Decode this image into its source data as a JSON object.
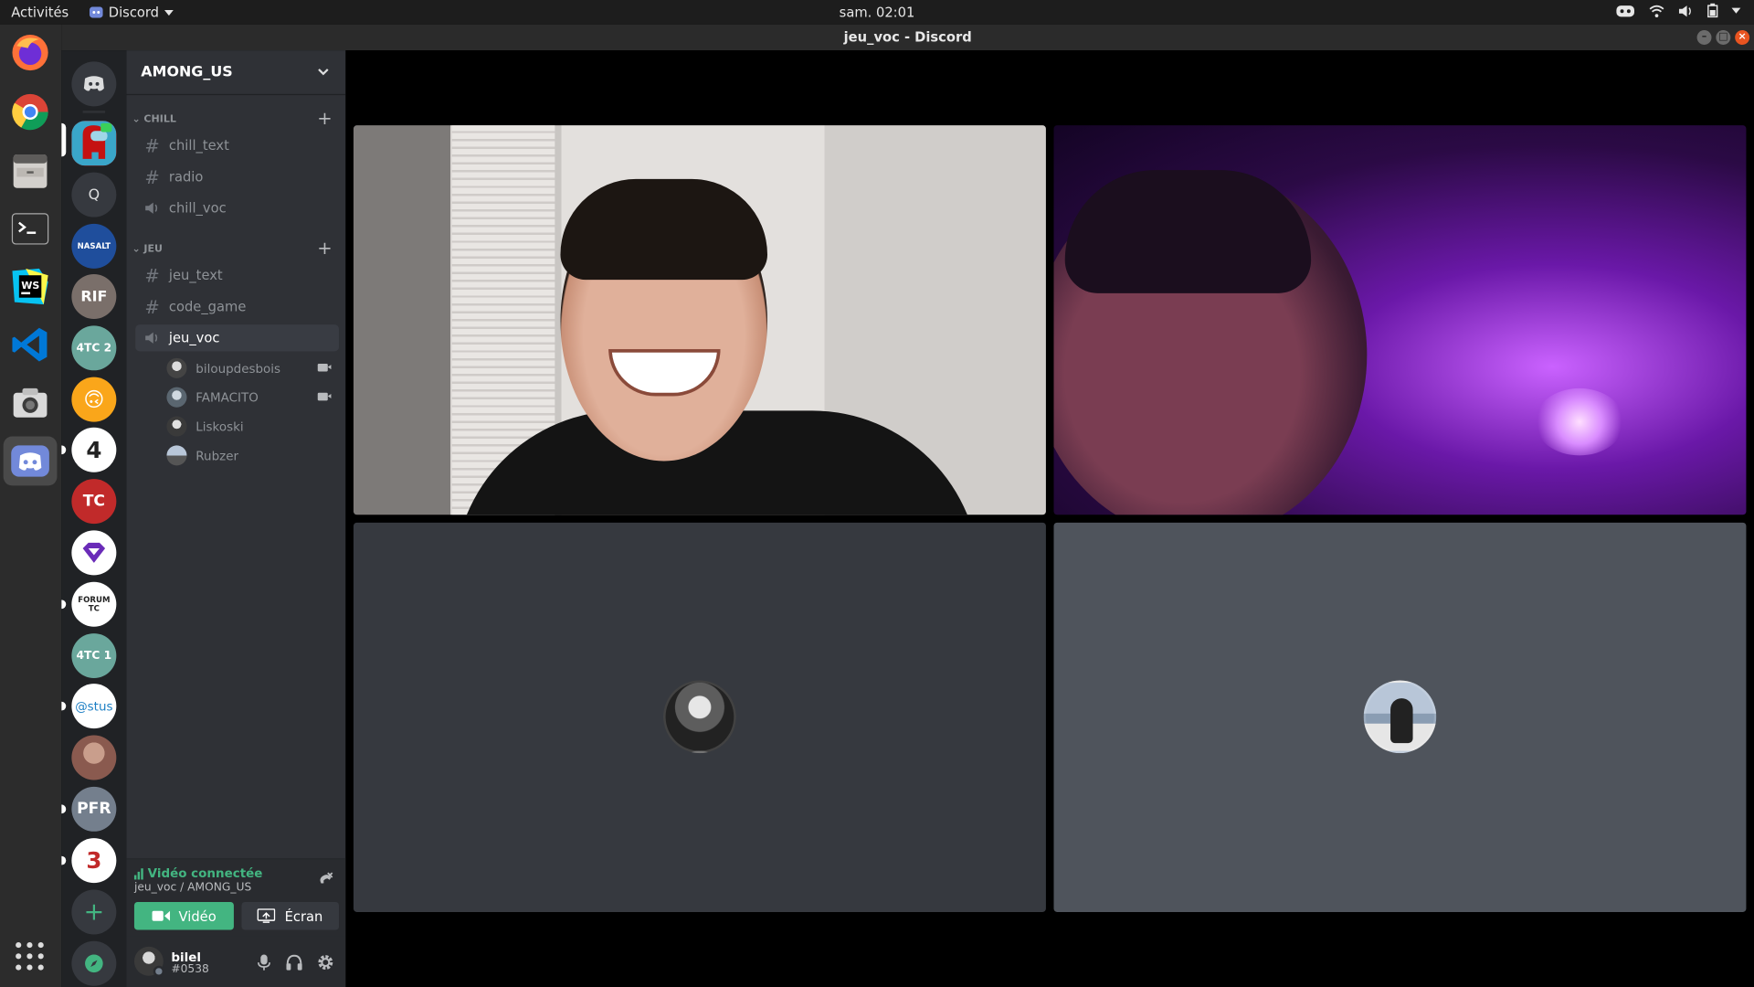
{
  "system": {
    "activities": "Activités",
    "app_name": "Discord",
    "clock": "sam. 02:01"
  },
  "window": {
    "title": "jeu_voc - Discord"
  },
  "dock": {
    "apps": [
      "firefox",
      "chrome",
      "files",
      "terminal",
      "webstorm",
      "vscode",
      "camera",
      "discord"
    ]
  },
  "servers": [
    {
      "label": "",
      "color": "#ed4245"
    },
    {
      "label": "Q",
      "color": "#36393f"
    },
    {
      "label": "NASALT",
      "color": "#1f4e9c"
    },
    {
      "label": "RIF",
      "color": "#7a6f6a"
    },
    {
      "label": "4TC 2",
      "color": "#6aa79c"
    },
    {
      "label": "🙃",
      "color": "#faa61a"
    },
    {
      "label": "4",
      "color": "#ffffff"
    },
    {
      "label": "TC",
      "color": "#c12a2a"
    },
    {
      "label": "",
      "color": "#ffffff"
    },
    {
      "label": "FORUM TC",
      "color": "#ffffff"
    },
    {
      "label": "4TC 1",
      "color": "#6aa79c"
    },
    {
      "label": "@stus",
      "color": "#ffffff"
    },
    {
      "label": "",
      "color": "#8a5a4f"
    },
    {
      "label": "PFR",
      "color": "#747f8d"
    },
    {
      "label": "3",
      "color": "#ffffff"
    }
  ],
  "guild": {
    "name": "AMONG_US"
  },
  "categories": [
    {
      "name": "CHILL",
      "channels": [
        {
          "name": "chill_text",
          "type": "text"
        },
        {
          "name": "radio",
          "type": "text"
        },
        {
          "name": "chill_voc",
          "type": "voice"
        }
      ]
    },
    {
      "name": "JEU",
      "channels": [
        {
          "name": "jeu_text",
          "type": "text"
        },
        {
          "name": "code_game",
          "type": "text"
        },
        {
          "name": "jeu_voc",
          "type": "voice",
          "selected": true
        }
      ]
    }
  ],
  "voice_users": [
    {
      "name": "biloupdesbois",
      "camera": true
    },
    {
      "name": "FAMACITO",
      "camera": true
    },
    {
      "name": "Liskoski",
      "camera": false
    },
    {
      "name": "Rubzer",
      "camera": false
    }
  ],
  "voice_connection": {
    "status": "Vidéo connectée",
    "location": "jeu_voc / AMONG_US",
    "video_label": "Vidéo",
    "screen_label": "Écran"
  },
  "user": {
    "name": "bilel",
    "tag": "#0538"
  },
  "colors": {
    "accent_green": "#43b581",
    "server_rail": "#202225",
    "sidebar": "#2f3136",
    "tile_dark": "#36393f",
    "tile_gray": "#4f545c"
  }
}
